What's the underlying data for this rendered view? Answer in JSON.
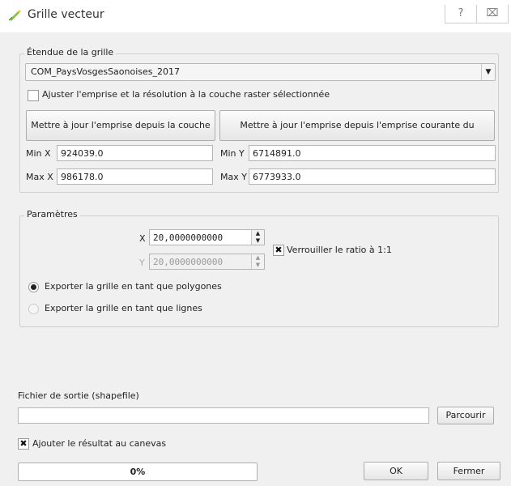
{
  "window": {
    "title": "Grille vecteur",
    "help_button": "?",
    "close_button": "⌧"
  },
  "extent": {
    "legend": "Étendue de la grille",
    "layer_combo": "COM_PaysVosgesSaonoises_2017",
    "adjust_checkbox_label": "Ajuster l'emprise et la résolution à la couche raster sélectionnée",
    "update_from_layer_button": "Mettre à jour l'emprise depuis la couche",
    "update_from_canvas_button": "Mettre à jour l'emprise depuis l'emprise courante du canevas",
    "min_x_label": "Min X",
    "min_x_value": "924039.0",
    "min_y_label": "Min Y",
    "min_y_value": "6714891.0",
    "max_x_label": "Max X",
    "max_x_value": "986178.0",
    "max_y_label": "Max Y",
    "max_y_value": "6773933.0"
  },
  "params": {
    "legend": "Paramètres",
    "x_label": "X",
    "x_value": "20,0000000000",
    "y_label": "Y",
    "y_value": "20,0000000000",
    "lock_ratio_label": "Verrouiller le ratio à 1:1",
    "lock_ratio_checked": true,
    "radio_polygons": "Exporter la grille en tant que polygones",
    "radio_lines": "Exporter la grille en tant que lignes",
    "selected_export": "polygons"
  },
  "output": {
    "label": "Fichier de sortie (shapefile)",
    "path_value": "",
    "browse_button": "Parcourir",
    "add_to_canvas_label": "Ajouter le résultat au canevas",
    "add_to_canvas_checked": true
  },
  "footer": {
    "progress_text": "0%",
    "progress": 0,
    "ok_button": "OK",
    "close_button": "Fermer"
  },
  "colors": {
    "window_bg": "#f0f0f0",
    "icon_green": "#6aa84f"
  }
}
